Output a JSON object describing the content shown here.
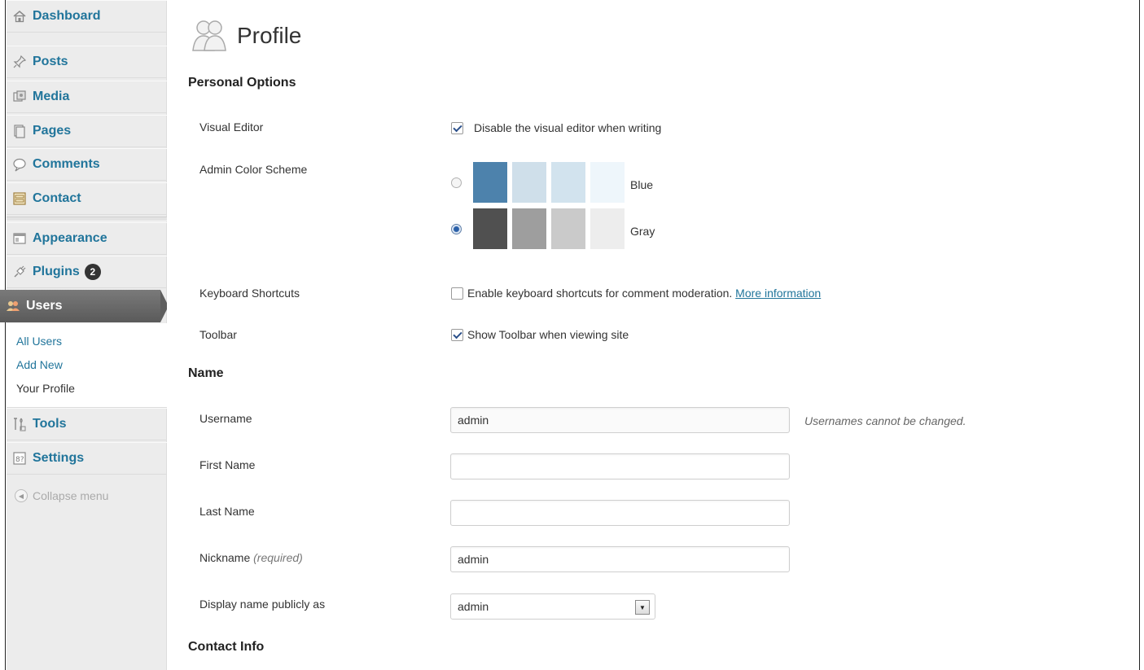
{
  "sidebar": {
    "items": [
      {
        "label": "Dashboard",
        "icon": "home-icon"
      },
      {
        "label": "Posts",
        "icon": "pushpin-icon"
      },
      {
        "label": "Media",
        "icon": "media-icon"
      },
      {
        "label": "Pages",
        "icon": "pages-icon"
      },
      {
        "label": "Comments",
        "icon": "comment-bubble-icon"
      },
      {
        "label": "Contact",
        "icon": "contact-form-icon"
      },
      {
        "label": "Appearance",
        "icon": "appearance-icon"
      },
      {
        "label": "Plugins",
        "icon": "plug-icon",
        "badge": "2"
      },
      {
        "label": "Users",
        "icon": "users-icon",
        "active": true
      },
      {
        "label": "Tools",
        "icon": "tools-icon"
      },
      {
        "label": "Settings",
        "icon": "settings-icon"
      }
    ],
    "submenu": [
      {
        "label": "All Users"
      },
      {
        "label": "Add New"
      },
      {
        "label": "Your Profile",
        "current": true
      }
    ],
    "collapse_label": "Collapse menu"
  },
  "page": {
    "title": "Profile",
    "personal_options": {
      "heading": "Personal Options",
      "visual_editor_label": "Visual Editor",
      "visual_editor_option": "Disable the visual editor when writing",
      "visual_editor_checked": true,
      "color_scheme_label": "Admin Color Scheme",
      "schemes": [
        {
          "name": "Blue",
          "selected": false,
          "colors": [
            "#4d82ac",
            "#cfdfea",
            "#d2e3ee",
            "#eef6fb"
          ]
        },
        {
          "name": "Gray",
          "selected": true,
          "colors": [
            "#505050",
            "#9e9e9e",
            "#cacaca",
            "#ededed"
          ]
        }
      ],
      "keyboard_label": "Keyboard Shortcuts",
      "keyboard_option": "Enable keyboard shortcuts for comment moderation.",
      "keyboard_link": "More information",
      "keyboard_checked": false,
      "toolbar_label": "Toolbar",
      "toolbar_option": "Show Toolbar when viewing site",
      "toolbar_checked": true
    },
    "name": {
      "heading": "Name",
      "username_label": "Username",
      "username_value": "admin",
      "username_hint": "Usernames cannot be changed.",
      "first_name_label": "First Name",
      "first_name_value": "",
      "last_name_label": "Last Name",
      "last_name_value": "",
      "nickname_label": "Nickname",
      "nickname_required": "(required)",
      "nickname_value": "admin",
      "display_label": "Display name publicly as",
      "display_value": "admin"
    },
    "contact": {
      "heading": "Contact Info"
    }
  }
}
